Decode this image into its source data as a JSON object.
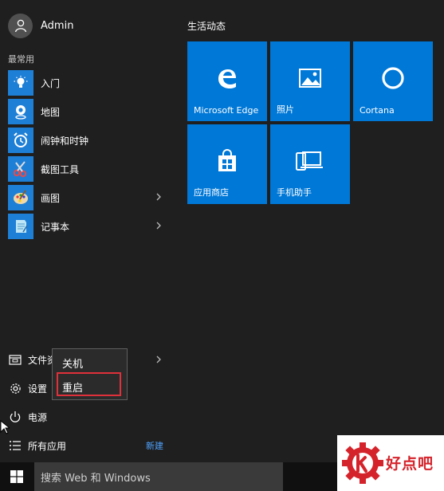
{
  "user": {
    "name": "Admin",
    "icon": "user-avatar-icon"
  },
  "most_used_label": "最常用",
  "apps": [
    {
      "label": "入门",
      "icon": "lightbulb-icon",
      "has_arrow": false
    },
    {
      "label": "地图",
      "icon": "maps-icon",
      "has_arrow": false
    },
    {
      "label": "闹钟和时钟",
      "icon": "alarm-clock-icon",
      "has_arrow": false
    },
    {
      "label": "截图工具",
      "icon": "snipping-tool-icon",
      "has_arrow": false
    },
    {
      "label": "画图",
      "icon": "paint-icon",
      "has_arrow": true
    },
    {
      "label": "记事本",
      "icon": "notepad-icon",
      "has_arrow": true
    }
  ],
  "bottom": {
    "file_explorer": {
      "label": "文件资",
      "icon": "file-explorer-icon"
    },
    "settings": {
      "label": "设置",
      "icon": "gear-icon"
    },
    "power": {
      "label": "电源",
      "icon": "power-icon"
    },
    "all_apps": {
      "label": "所有应用",
      "icon": "list-icon",
      "badge": "新建"
    }
  },
  "power_menu": {
    "shutdown": "关机",
    "restart": "重启"
  },
  "live_section_label": "生活动态",
  "tiles": [
    {
      "label": "Microsoft Edge",
      "icon": "edge-icon"
    },
    {
      "label": "照片",
      "icon": "photos-icon"
    },
    {
      "label": "Cortana",
      "icon": "cortana-icon"
    },
    {
      "label": "应用商店",
      "icon": "store-icon"
    },
    {
      "label": "手机助手",
      "icon": "phone-companion-icon"
    }
  ],
  "taskbar": {
    "search_placeholder": "搜索 Web 和 Windows",
    "start_icon": "windows-logo-icon"
  },
  "watermark": {
    "text": "好点吧"
  },
  "colors": {
    "tile": "#0078d7",
    "background": "#1f1f1f",
    "highlight": "#e0313a",
    "link": "#4fa3ff"
  }
}
